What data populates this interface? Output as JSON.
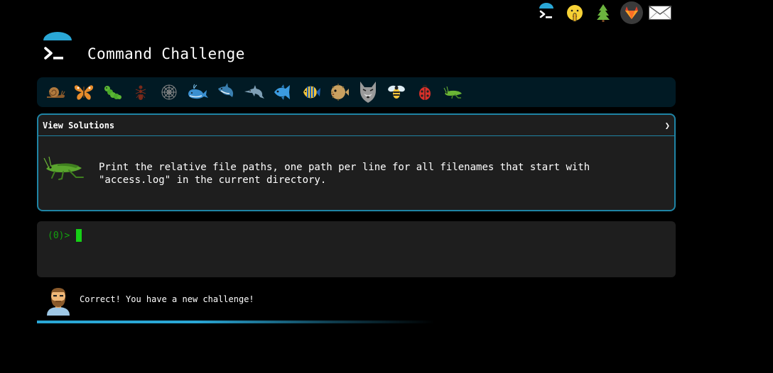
{
  "header": {
    "title": "Command Challenge",
    "logo_icon": "terminal-prompt-icon"
  },
  "top_icons": [
    "terminal-prompt-icon",
    "shushing-face-icon",
    "tree-icon",
    "gitlab-icon",
    "envelope-icon"
  ],
  "levels": [
    {
      "icon": "snail-icon"
    },
    {
      "icon": "butterfly-icon"
    },
    {
      "icon": "caterpillar-icon"
    },
    {
      "icon": "ant-icon"
    },
    {
      "icon": "spider-web-icon"
    },
    {
      "icon": "whale-icon"
    },
    {
      "icon": "shark-icon"
    },
    {
      "icon": "dolphin-icon"
    },
    {
      "icon": "fish-icon"
    },
    {
      "icon": "tropical-fish-icon"
    },
    {
      "icon": "blowfish-icon"
    },
    {
      "icon": "wolf-icon"
    },
    {
      "icon": "bee-icon"
    },
    {
      "icon": "ladybug-icon"
    },
    {
      "icon": "cricket-icon",
      "current": true
    }
  ],
  "challenge": {
    "view_solutions_label": "View Solutions",
    "toggle_glyph": "❯",
    "mascot_icon": "cricket-icon",
    "description": "Print the relative file paths, one path per line for all filenames that start with \"access.log\" in the current directory."
  },
  "terminal": {
    "prompt": "(0)>"
  },
  "feedback": {
    "avatar_icon": "bearded-man-icon",
    "message": "Correct! You have a new challenge!",
    "progress": 0.55
  },
  "colors": {
    "accent": "#1f84a5",
    "strip_bg": "#011a24",
    "panel_bg": "#1e1e1e",
    "prompt_green": "#13a10e",
    "cursor_green": "#16d016",
    "progress_blue": "#2aa7d6"
  }
}
